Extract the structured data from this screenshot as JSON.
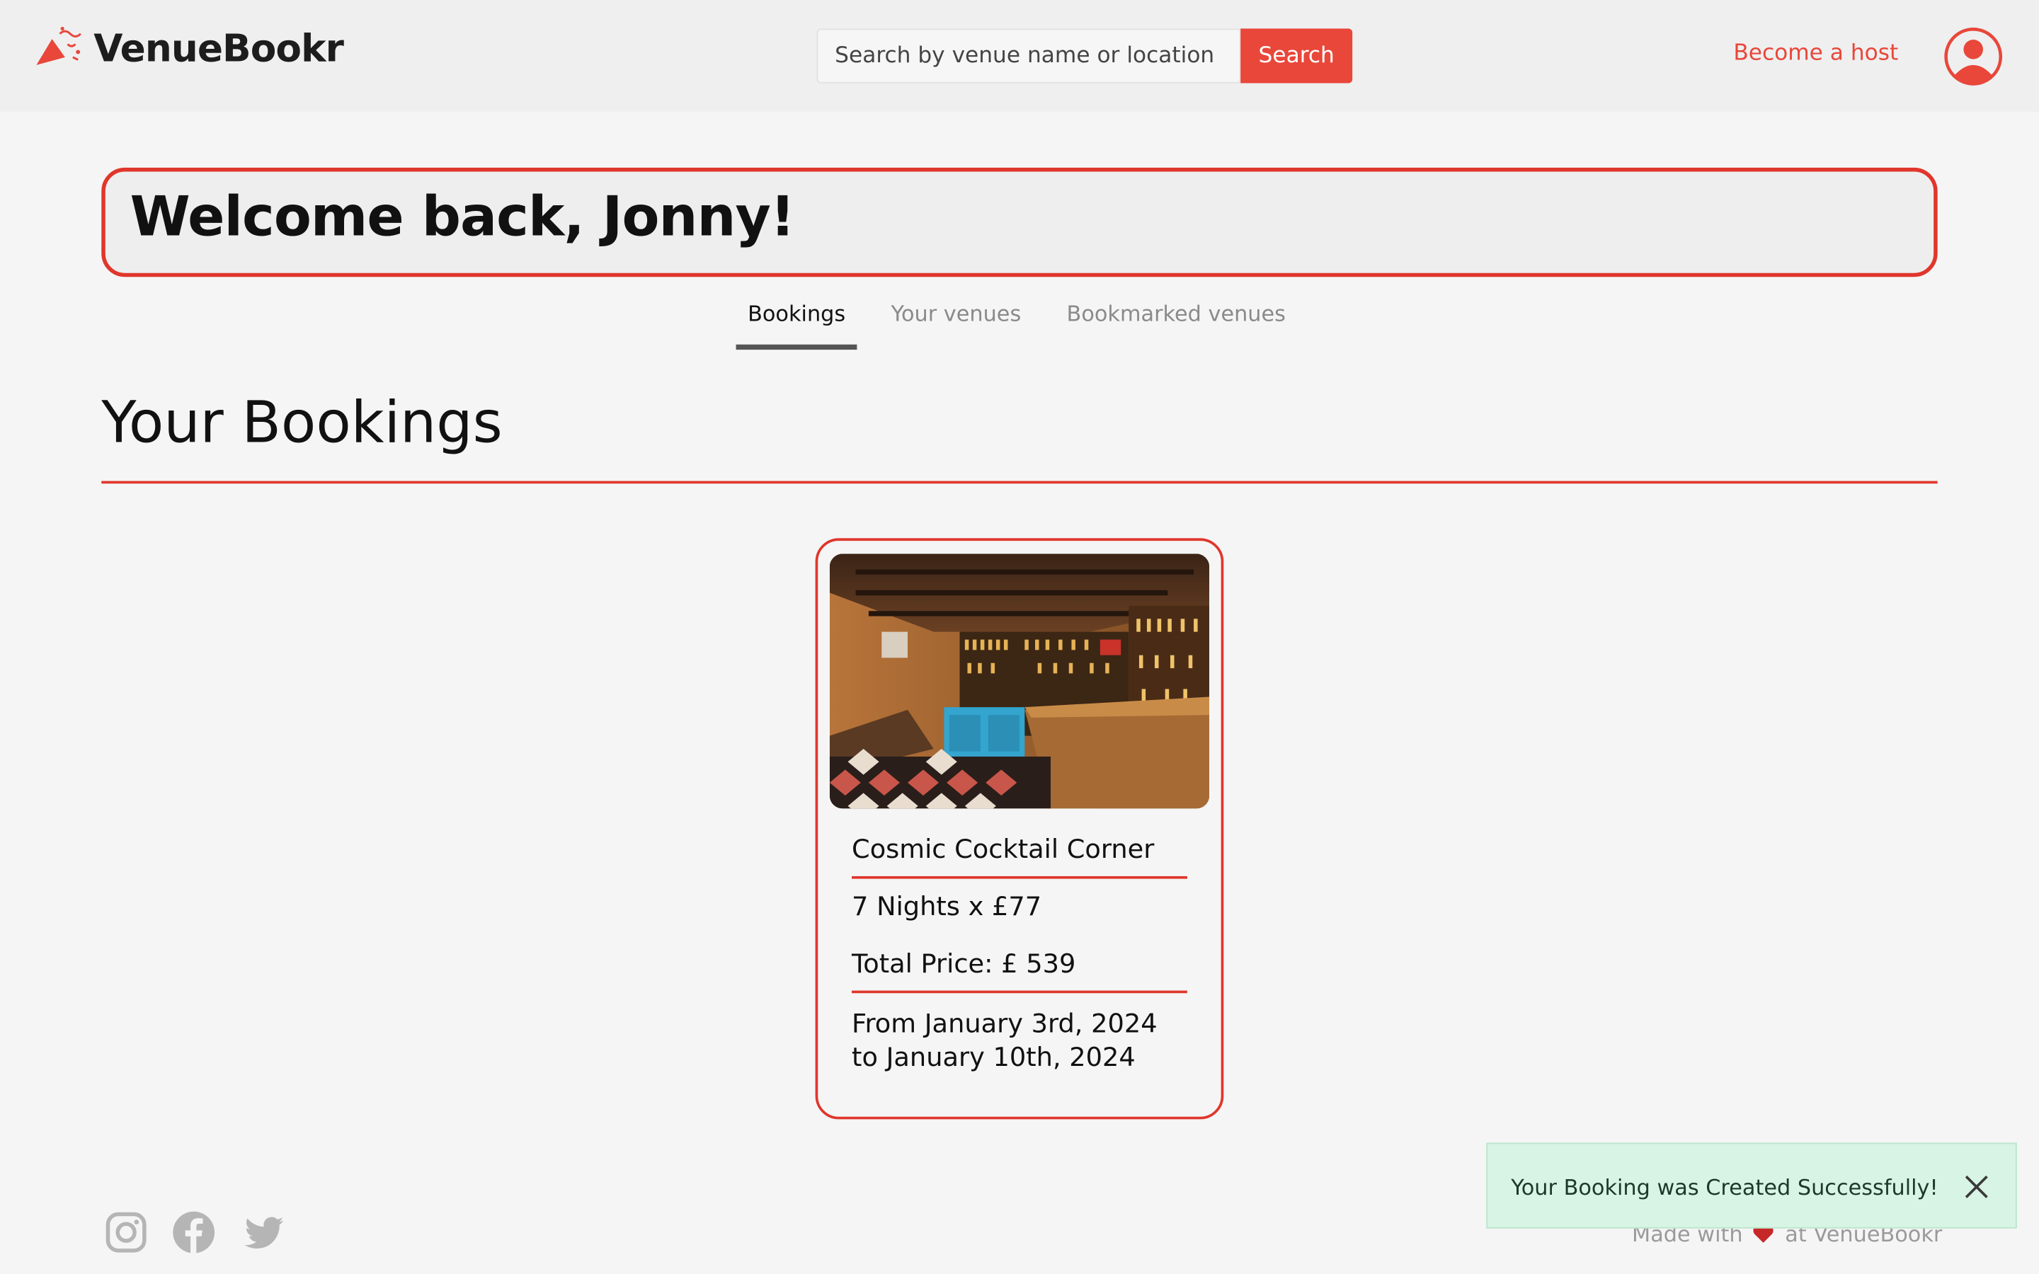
{
  "header": {
    "brand": "VenueBookr",
    "search": {
      "placeholder": "Search by venue name or location",
      "value": "",
      "button_label": "Search"
    },
    "host_link": "Become a host"
  },
  "welcome": {
    "title": "Welcome back, Jonny!"
  },
  "tabs": [
    {
      "label": "Bookings",
      "active": true
    },
    {
      "label": "Your venues",
      "active": false
    },
    {
      "label": "Bookmarked venues",
      "active": false
    }
  ],
  "section": {
    "title": "Your Bookings"
  },
  "bookings": [
    {
      "venue_name": "Cosmic Cocktail Corner",
      "nights_line": "7 Nights x £77",
      "total_line": "Total Price: £ 539",
      "dates_line_1": "From January 3rd, 2024",
      "dates_line_2": "to January 10th, 2024"
    }
  ],
  "footer": {
    "social_icons": [
      "instagram-icon",
      "facebook-icon",
      "twitter-icon"
    ],
    "made_with_prefix": "Made with",
    "made_with_suffix": "at VenueBookr"
  },
  "toast": {
    "message": "Your Booking was Created Successfully!"
  },
  "colors": {
    "accent": "#e8473a",
    "border_red": "#e0362c",
    "toast_bg": "#d8f4e4",
    "page_bg": "#f5f5f5"
  }
}
